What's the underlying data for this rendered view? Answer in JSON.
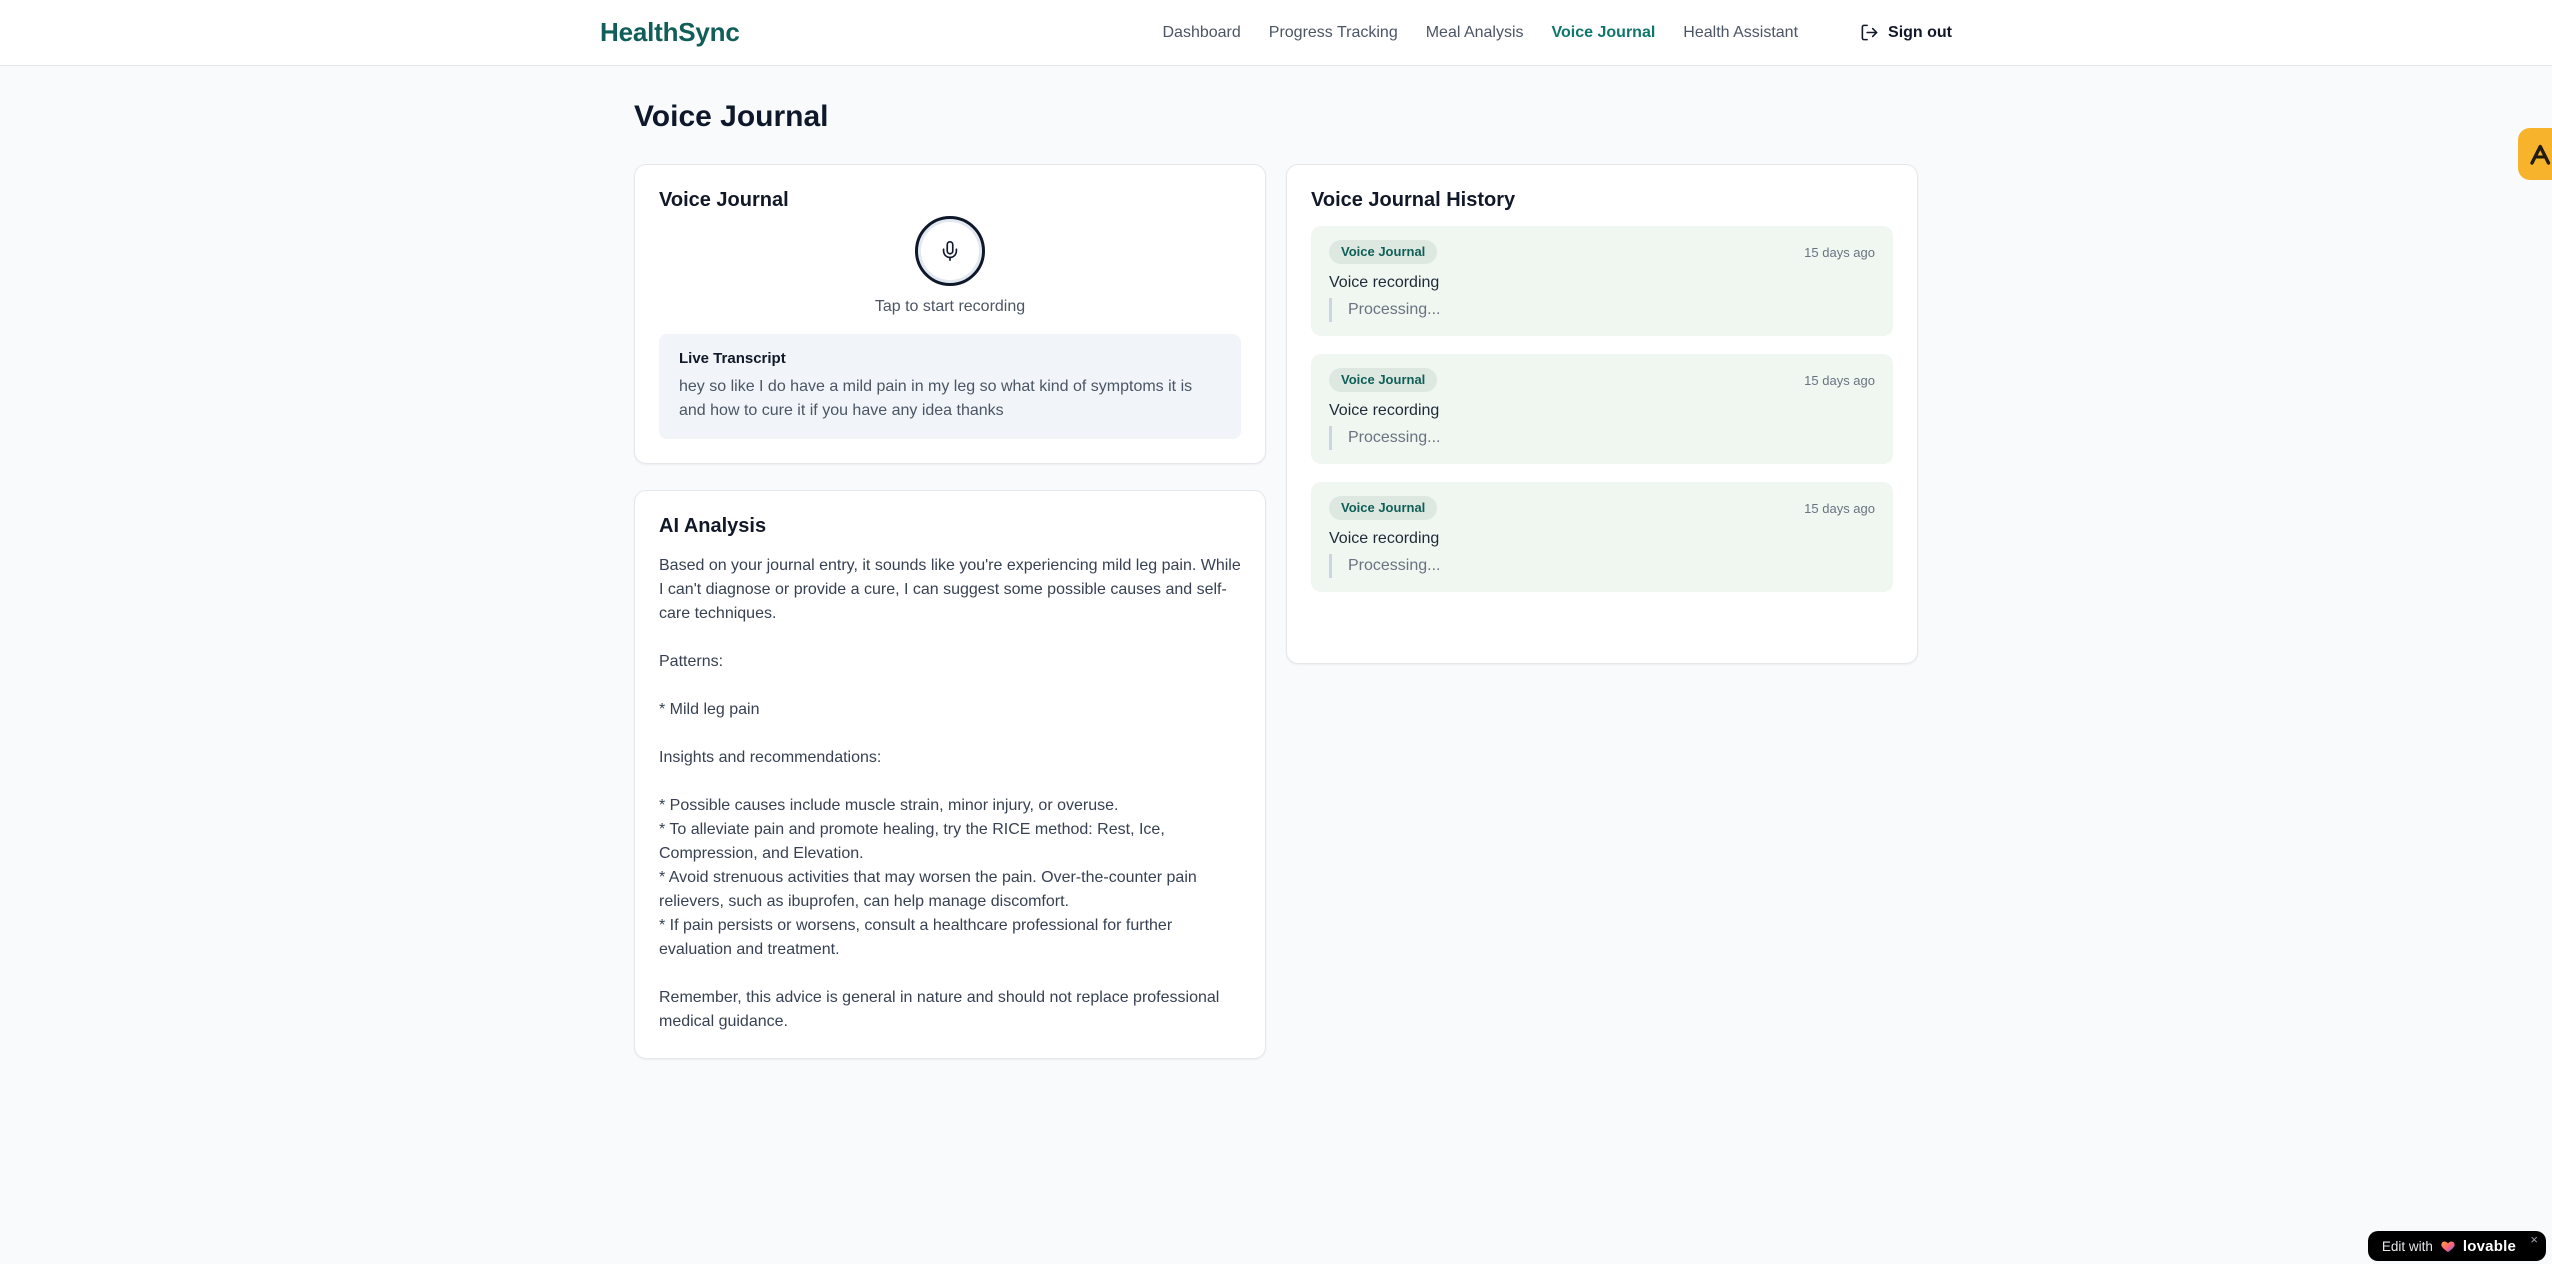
{
  "brand": {
    "name": "HealthSync"
  },
  "nav": {
    "items": [
      {
        "label": "Dashboard",
        "active": false
      },
      {
        "label": "Progress Tracking",
        "active": false
      },
      {
        "label": "Meal Analysis",
        "active": false
      },
      {
        "label": "Voice Journal",
        "active": true
      },
      {
        "label": "Health Assistant",
        "active": false
      }
    ],
    "sign_out_label": "Sign out"
  },
  "page": {
    "title": "Voice Journal"
  },
  "recorder_card": {
    "title": "Voice Journal",
    "tap_hint": "Tap to start recording",
    "transcript_title": "Live Transcript",
    "transcript_text": "hey so like I do have a mild pain in my leg so what kind of symptoms it is and how to cure it if you have any idea thanks"
  },
  "analysis_card": {
    "title": "AI Analysis",
    "body": "Based on your journal entry, it sounds like you're experiencing mild leg pain. While I can't diagnose or provide a cure, I can suggest some possible causes and self-care techniques.\n\nPatterns:\n\n* Mild leg pain\n\nInsights and recommendations:\n\n* Possible causes include muscle strain, minor injury, or overuse.\n* To alleviate pain and promote healing, try the RICE method: Rest, Ice, Compression, and Elevation.\n* Avoid strenuous activities that may worsen the pain. Over-the-counter pain relievers, such as ibuprofen, can help manage discomfort.\n* If pain persists or worsens, consult a healthcare professional for further evaluation and treatment.\n\nRemember, this advice is general in nature and should not replace professional medical guidance."
  },
  "history": {
    "title": "Voice Journal History",
    "entries": [
      {
        "badge": "Voice Journal",
        "time": "15 days ago",
        "label": "Voice recording",
        "status": "Processing..."
      },
      {
        "badge": "Voice Journal",
        "time": "15 days ago",
        "label": "Voice recording",
        "status": "Processing..."
      },
      {
        "badge": "Voice Journal",
        "time": "15 days ago",
        "label": "Voice recording",
        "status": "Processing..."
      }
    ]
  },
  "widgets": {
    "feedback_badge_icon": "lambda-logo-icon",
    "edit_badge": {
      "prefix": "Edit with",
      "brand": "lovable",
      "close": "×",
      "heart_icon": "gradient-heart-icon"
    }
  },
  "colors": {
    "brand_teal": "#115e59",
    "active_nav_teal": "#0f766e",
    "badge_amber": "#f6b32b",
    "history_entry_bg": "#f0f7f1",
    "entry_badge_bg": "#dde9e0",
    "page_bg": "#f8fafc"
  }
}
